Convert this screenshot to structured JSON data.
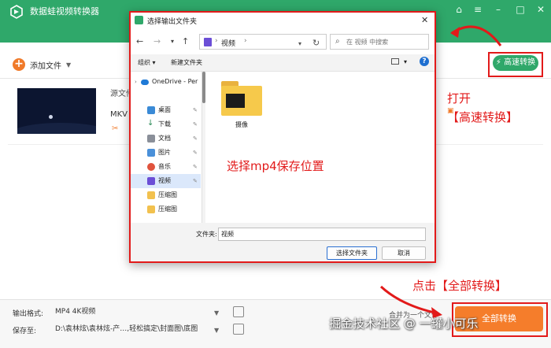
{
  "app": {
    "title": "数据蛙视频转换器",
    "add_file": "添加文件",
    "high_speed": "高速转换",
    "file": {
      "source_label": "源文件",
      "format": "MKV"
    },
    "bottom": {
      "output_format_label": "输出格式:",
      "output_format_value": "MP4 4K视频",
      "save_to_label": "保存至:",
      "save_to_value": "D:\\袁林炫\\袁林炫-产…,轻松搞定\\封面图\\底图",
      "merge_label": "合并为一个文件",
      "convert_all": "全部转换"
    }
  },
  "dialog": {
    "title": "选择输出文件夹",
    "address": {
      "segment": "视频"
    },
    "search_placeholder": "在 视频 中搜索",
    "commands": {
      "organize": "组织",
      "new_folder": "新建文件夹"
    },
    "sidebar": [
      {
        "label": "OneDrive - Per",
        "icon": "cloud-icon",
        "pinned": false,
        "selected": false
      },
      {
        "label": "桌面",
        "icon": "desktop-icon",
        "pinned": true,
        "selected": false
      },
      {
        "label": "下载",
        "icon": "download-icon",
        "pinned": true,
        "selected": false
      },
      {
        "label": "文档",
        "icon": "document-icon",
        "pinned": true,
        "selected": false
      },
      {
        "label": "图片",
        "icon": "picture-icon",
        "pinned": true,
        "selected": false
      },
      {
        "label": "音乐",
        "icon": "music-icon",
        "pinned": true,
        "selected": false
      },
      {
        "label": "视频",
        "icon": "video-icon",
        "pinned": true,
        "selected": true
      },
      {
        "label": "压缩图",
        "icon": "folder-icon",
        "pinned": false,
        "selected": false
      },
      {
        "label": "压缩图",
        "icon": "folder-icon",
        "pinned": false,
        "selected": false
      }
    ],
    "folder_name": "摄像",
    "folder_field_label": "文件夹:",
    "folder_field_value": "视频",
    "select_button": "选择文件夹",
    "cancel_button": "取消"
  },
  "annotations": {
    "open": "打开",
    "high_speed": "【高速转换】",
    "choose_location": "选择mp4保存位置",
    "convert_all": "点击【全部转换】"
  },
  "watermark": "掘金技术社区 @ 一罐小可乐",
  "colors": {
    "brand_green": "#2fa86a",
    "accent_orange": "#f57d2b",
    "annotation_red": "#e21a1a"
  }
}
